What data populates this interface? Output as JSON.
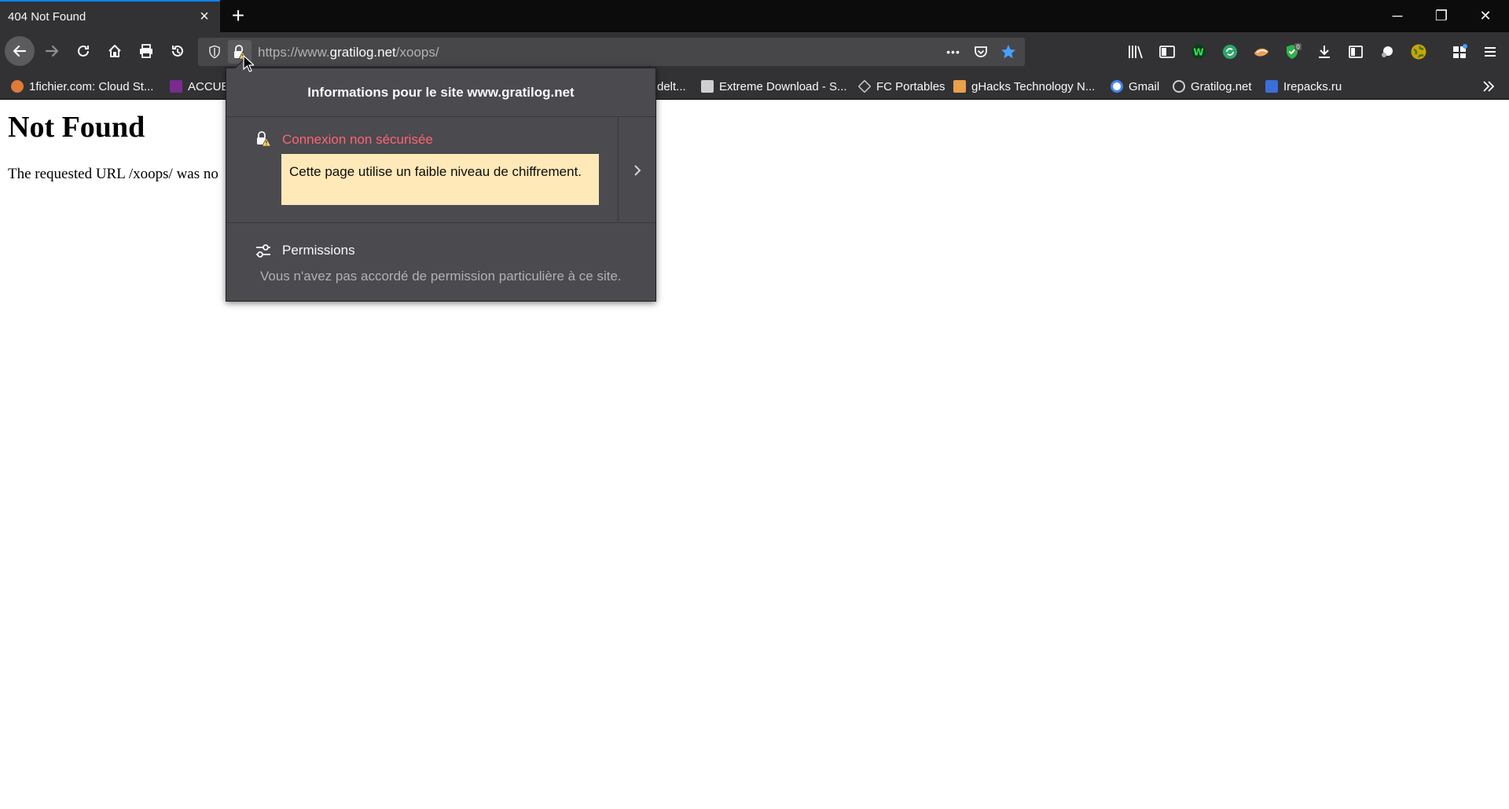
{
  "tab": {
    "title": "404 Not Found",
    "close_label": "×",
    "new_tab_label": "+"
  },
  "window_controls": {
    "minimize": "─",
    "restore": "❐",
    "close": "✕"
  },
  "urlbar": {
    "scheme_prefix": "https://www.",
    "host": "gratilog.net",
    "path": "/xoops/",
    "more_label": "•••"
  },
  "toolbar": {
    "badge_count": "0"
  },
  "bookmarks": [
    {
      "label": "1fichier.com: Cloud St...",
      "color": "#e07b39"
    },
    {
      "label": "ACCUE",
      "color": "#7a2b8f"
    },
    {
      "label": "delt...",
      "color": ""
    },
    {
      "label": "Extreme Download - S...",
      "color": "#cfcfcf"
    },
    {
      "label": "FC Portables",
      "color": "#cfcfcf"
    },
    {
      "label": "gHacks Technology N...",
      "color": "#e8a04a"
    },
    {
      "label": "Gmail",
      "color": "#4285f4"
    },
    {
      "label": "Gratilog.net",
      "color": "#cfcfcf"
    },
    {
      "label": "Irepacks.ru",
      "color": "#3a6fd8"
    }
  ],
  "page": {
    "heading": "Not Found",
    "message": "The requested URL /xoops/ was no"
  },
  "site_info": {
    "title": "Informations pour le site www.gratilog.net",
    "connection_label": "Connexion non sécurisée",
    "warning": "Cette page utilise un faible niveau de chiffrement.",
    "permissions_title": "Permissions",
    "permissions_desc": "Vous n'avez pas accordé de permission particulière à ce site."
  },
  "colors": {
    "accent": "#0a84ff",
    "insecure_text": "#ff6472",
    "warning_bg": "#ffe9b8",
    "toolbar_bg": "#323234",
    "popup_bg": "#4a4a4f"
  }
}
